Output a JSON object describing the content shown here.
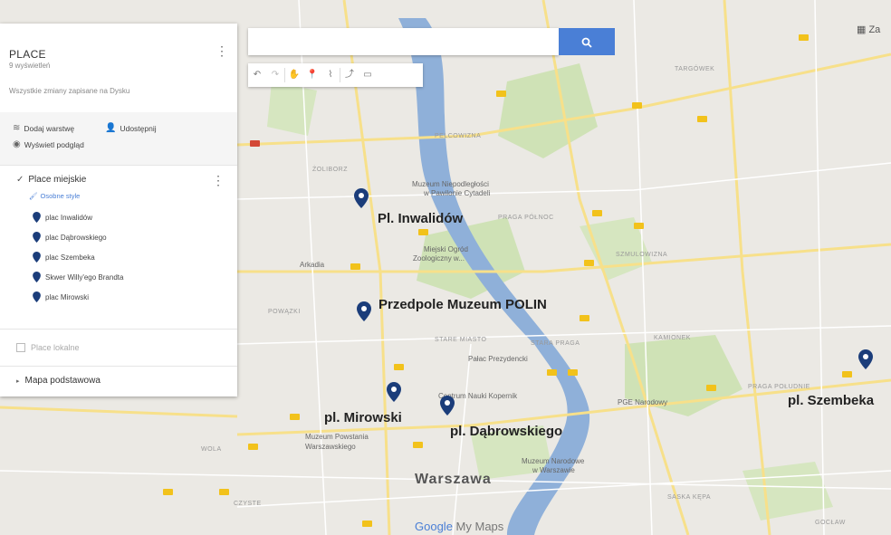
{
  "colors": {
    "accent": "#4a7fd6",
    "pin": "#1b3d7a",
    "river": "#8fb0d9",
    "park": "#c9dfb0",
    "road": "#f2c21b"
  },
  "panel": {
    "title": "PLACE",
    "subtitle": "9 wyświetleń",
    "saved_note": "Wszystkie zmiany zapisane na Dysku",
    "actions": {
      "add_layer": "Dodaj warstwę",
      "share": "Udostępnij",
      "preview": "Wyświetl podgląd"
    },
    "layer": {
      "title": "Place miejskie",
      "style": "Osobne style",
      "items": [
        {
          "label": "plac Inwalidów"
        },
        {
          "label": "plac Dąbrowskiego"
        },
        {
          "label": "plac Szembeka"
        },
        {
          "label": "Skwer Willy'ego Brandta"
        },
        {
          "label": "plac Mirowski"
        }
      ]
    },
    "local_places": "Place lokalne",
    "base_map": "Mapa podstawowa"
  },
  "search": {
    "placeholder": ""
  },
  "toolbar": {
    "icons": [
      "undo-icon",
      "redo-icon",
      "hand-icon",
      "marker-icon",
      "line-icon",
      "route-icon",
      "ruler-icon"
    ]
  },
  "map": {
    "places": {
      "inwalidow": "Pl. Inwalidów",
      "polin": "Przedpole Muzeum POLIN",
      "mirowski": "pl. Mirowski",
      "dabrowskiego": "pl. Dąbrowskiego",
      "szembeka": "pl. Szembeka"
    },
    "city": "Warszawa",
    "poi": {
      "niepodleglosci": "Muzeum Niepodległości",
      "cytadela": "w Pawilonie Cytadeli",
      "zoo1": "Miejski Ogród",
      "zoo2": "Zoologiczny w...",
      "arkadia": "Arkadia",
      "palac": "Pałac Prezydencki",
      "kopernik": "Centrum Nauki Kopernik",
      "pge": "PGE Narodowy",
      "powstania1": "Muzeum Powstania",
      "powstania2": "Warszawskiego",
      "narodowe1": "Muzeum Narodowe",
      "narodowe2": "w Warszawie"
    },
    "districts": {
      "zoliborz": "ŻOLIBORZ",
      "pelcowizna": "PELCOWIZNA",
      "targowek": "TARGÓWEK",
      "praga_polnoc": "PRAGA PÓŁNOC",
      "szmulowizna": "SZMULOWIZNA",
      "powazki": "POWĄZKI",
      "stare_miasto": "STARE MIASTO",
      "stara_praga": "STARA PRAGA",
      "kamionek": "KAMIONEK",
      "praga_poludnie": "PRAGA POŁUDNIE",
      "wola": "WOLA",
      "czyste": "CZYSTE",
      "saska_kepa": "SASKA KĘPA",
      "goclaw": "GOCŁAW"
    },
    "footer": {
      "google": "Google",
      "mymaps": "My Maps"
    }
  }
}
